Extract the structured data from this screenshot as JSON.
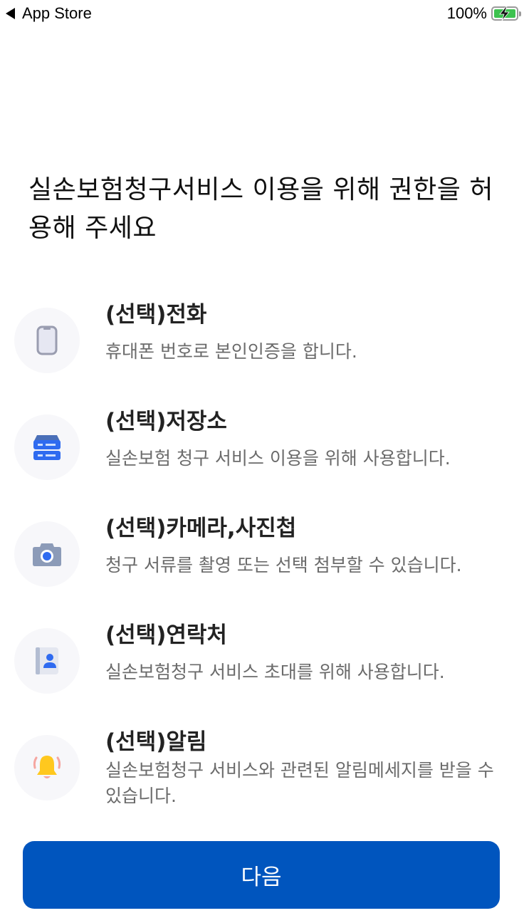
{
  "status_bar": {
    "back_label": "App Store",
    "battery_percent": "100%",
    "battery_level": 1.0,
    "charging": true
  },
  "header": {
    "title": "실손보험청구서비스 이용을 위해 권한을 허용해 주세요"
  },
  "permissions": [
    {
      "icon": "phone-icon",
      "title": "(선택)전화",
      "description": "휴대폰 번호로 본인인증을 합니다."
    },
    {
      "icon": "storage-icon",
      "title": "(선택)저장소",
      "description": "실손보험 청구 서비스 이용을 위해 사용합니다."
    },
    {
      "icon": "camera-icon",
      "title": "(선택)카메라,사진첩",
      "description": "청구 서류를 촬영 또는 선택 첨부할 수 있습니다."
    },
    {
      "icon": "contacts-icon",
      "title": "(선택)연락처",
      "description": "실손보험청구 서비스 초대를 위해 사용합니다."
    },
    {
      "icon": "bell-icon",
      "title": "(선택)알림",
      "description": "실손보험청구 서비스와 관련된 알림메세지를 받을 수 있습니다."
    }
  ],
  "footer": {
    "next_label": "다음"
  },
  "colors": {
    "primary": "#0055be",
    "icon_blue": "#2f6bf0",
    "battery_green": "#3dc24f",
    "bell_yellow": "#ffc81e"
  }
}
